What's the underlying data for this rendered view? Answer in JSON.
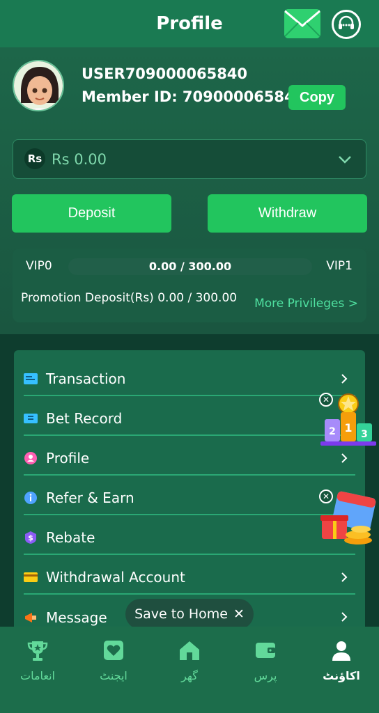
{
  "header": {
    "title": "Profile",
    "mail_icon": "mail-icon",
    "support_icon": "headset-icon"
  },
  "user": {
    "username": "USER709000065840",
    "member_id_label": "Member ID: 709000065840",
    "copy_label": "Copy"
  },
  "balance": {
    "currency_badge": "Rs",
    "amount": "Rs 0.00"
  },
  "actions": {
    "deposit_label": "Deposit",
    "withdraw_label": "Withdraw"
  },
  "vip": {
    "current": "VIP0",
    "next": "VIP1",
    "progress": "0.00 / 300.00",
    "progress_fraction": 0.0,
    "promotion": "Promotion Deposit(Rs) 0.00 / 300.00",
    "more_label": "More Privileges >"
  },
  "menu": {
    "items": [
      {
        "label": "Transaction",
        "icon": "receipt-icon",
        "color": "#36c0ff"
      },
      {
        "label": "Bet Record",
        "icon": "ticket-icon",
        "color": "#36c0ff"
      },
      {
        "label": "Profile",
        "icon": "user-icon",
        "color": "#ff5fb3"
      },
      {
        "label": "Refer & Earn",
        "icon": "info-icon",
        "color": "#4fa3ff"
      },
      {
        "label": "Rebate",
        "icon": "dollar-icon",
        "color": "#8b5cf6"
      },
      {
        "label": "Withdrawal Account",
        "icon": "card-icon",
        "color": "#facc15"
      },
      {
        "label": "Message",
        "icon": "megaphone-icon",
        "color": "#f97316"
      }
    ]
  },
  "toast": {
    "label": "Save to Home",
    "close": "✕"
  },
  "nav": {
    "items": [
      {
        "label": "انعامات",
        "icon": "trophy-icon",
        "active": false
      },
      {
        "label": "ایجنٹ",
        "icon": "agent-icon",
        "active": false
      },
      {
        "label": "گھر",
        "icon": "home-icon",
        "active": false
      },
      {
        "label": "پرس",
        "icon": "wallet-icon",
        "active": false
      },
      {
        "label": "اکاؤنٹ",
        "icon": "account-icon",
        "active": true
      }
    ]
  }
}
